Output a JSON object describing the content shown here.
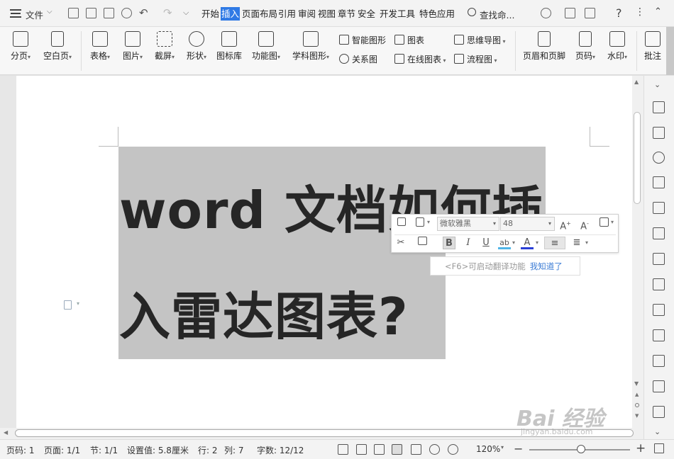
{
  "titlebar": {
    "menu_label": "文件",
    "tabs": [
      "开始",
      "插入",
      "页面布局",
      "引用",
      "审阅",
      "视图",
      "章节",
      "安全",
      "开发工具",
      "特色应用"
    ],
    "active_tab": "插入",
    "search_label": "查找命..."
  },
  "ribbon": {
    "big_buttons": [
      "分页",
      "空白页",
      "表格",
      "图片",
      "截屏",
      "形状",
      "图标库",
      "功能图",
      "学科图形"
    ],
    "small_items": [
      "智能图形",
      "图表",
      "思维导图",
      "关系图",
      "在线图表",
      "流程图"
    ],
    "right_buttons": [
      "页眉和页脚",
      "页码",
      "水印",
      "批注"
    ]
  },
  "document": {
    "heading_line1": "word 文档如何插",
    "heading_line2": "入雷达图表?"
  },
  "float_toolbar": {
    "font_name": "微软雅黑",
    "font_size": "48",
    "bold": "B",
    "italic": "I",
    "underline": "U"
  },
  "tip": {
    "text": "<F6>可启动翻译功能",
    "link": "我知道了"
  },
  "status": {
    "page": "页码: 1",
    "pages": "页面: 1/1",
    "section": "节: 1/1",
    "setting": "设置值: 5.8厘米",
    "row": "行: 2",
    "col": "列: 7",
    "words": "字数: 12/12",
    "zoom": "120%"
  },
  "watermark": {
    "brand": "Bai 经验",
    "url": "jingyan.baidu.com"
  }
}
